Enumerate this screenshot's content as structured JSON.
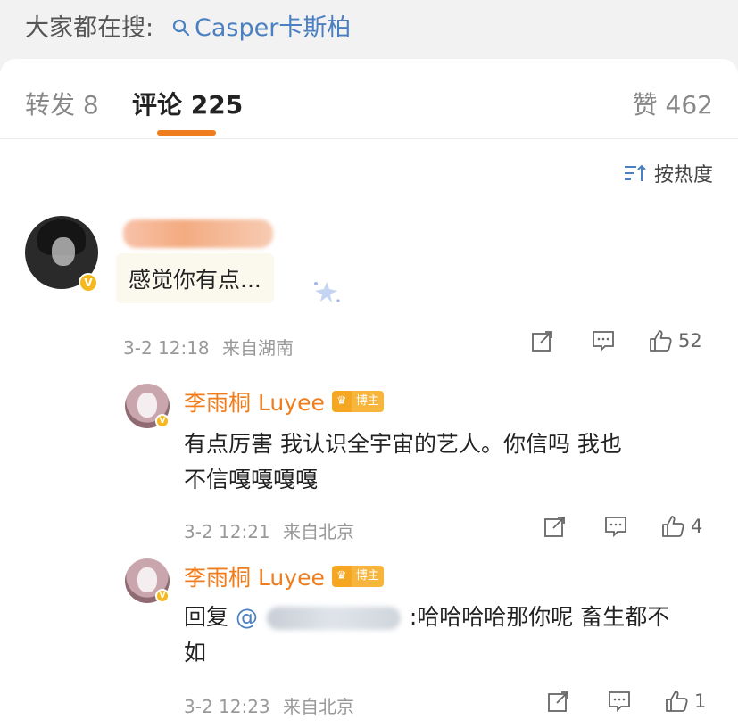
{
  "search": {
    "prefix": "大家都在搜:",
    "query": "Casper卡斯柏"
  },
  "tabs": {
    "repost_label": "转发",
    "repost_count": "8",
    "comments_label": "评论",
    "comments_count": "225",
    "likes_label": "赞",
    "likes_count": "462"
  },
  "sort": {
    "label": "按热度"
  },
  "comment": {
    "text": "感觉你有点...",
    "time": "3-2 12:18",
    "location": "来自湖南",
    "like_count": "52"
  },
  "replies": [
    {
      "author": "李雨桐 Luyee",
      "badge": "博主",
      "text_line1": "有点厉害 我认识全宇宙的艺人。你信吗 我也",
      "text_line2": "不信嘎嘎嘎嘎",
      "time": "3-2 12:21",
      "location": "来自北京",
      "like_count": "4"
    },
    {
      "author": "李雨桐 Luyee",
      "badge": "博主",
      "reply_prefix": "回复",
      "text_line1_suffix": ":哈哈哈哈那你呢 畜生都不",
      "text_line2": "如",
      "time": "3-2 12:23",
      "location": "来自北京",
      "like_count": "1"
    }
  ],
  "colors": {
    "accent": "#f07d1d",
    "link": "#4a7fc1",
    "verify": "#f5b81f"
  },
  "icons": [
    "search-icon",
    "sort-icon",
    "share-icon",
    "comment-icon",
    "like-icon",
    "verified-icon",
    "crown-icon"
  ]
}
